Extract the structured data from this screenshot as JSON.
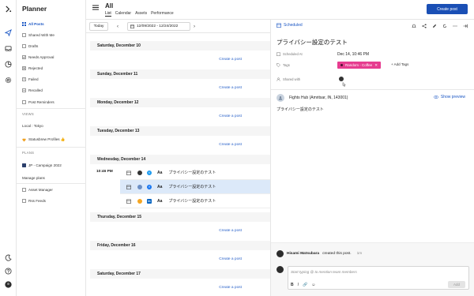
{
  "app": {
    "title": "Planner"
  },
  "sidebar": {
    "items": [
      {
        "label": "All Posts",
        "icon": "grid-icon"
      },
      {
        "label": "Shared With Me",
        "icon": "share-icon"
      },
      {
        "label": "Drafts",
        "icon": "draft-icon"
      },
      {
        "label": "Needs Approval",
        "icon": "approval-icon"
      },
      {
        "label": "Rejected",
        "icon": "rejected-icon"
      },
      {
        "label": "Failed",
        "icon": "failed-icon"
      },
      {
        "label": "Recalled",
        "icon": "recalled-icon"
      },
      {
        "label": "Post Reminders",
        "icon": "reminder-icon"
      }
    ],
    "views_heading": "VIEWS",
    "views": [
      {
        "label": "Local : Tokyo",
        "icon": ""
      },
      {
        "label": "Statusbrew Profiles 👍",
        "icon": "heart-icon"
      }
    ],
    "plans_heading": "PLANS",
    "plans": [
      {
        "label": "JP - Campaign 2022"
      },
      {
        "label": "Manage plans"
      }
    ],
    "tools": [
      {
        "label": "Asset Manager"
      },
      {
        "label": "Rss Feeds"
      }
    ]
  },
  "header": {
    "title": "All",
    "tabs": [
      "List",
      "Calendar",
      "Assets",
      "Performance"
    ],
    "create_label": "Create post"
  },
  "toolbar": {
    "today_label": "Today",
    "prev": "‹",
    "next": "›",
    "date_range": "12/09/2022 - 12/24/2022"
  },
  "calendar": {
    "create_label": "Create a post",
    "days": [
      "Saturday, December 10",
      "Sunday, December 11",
      "Monday, December 12",
      "Tuesday, December 13",
      "Wednesday, December 14",
      "Thursday, December 15",
      "Friday, December 16",
      "Saturday, December 17"
    ],
    "time": "10:46 PM",
    "posts": [
      {
        "network": "twitter",
        "aa": "Aa",
        "text": "プライバシー設定のテスト",
        "selected": false
      },
      {
        "network": "facebook",
        "aa": "Aa",
        "text": "プライバシー設定のテスト",
        "selected": true
      },
      {
        "network": "linkedin",
        "aa": "Aa",
        "text": "プライバシー設定のテスト",
        "selected": false
      }
    ]
  },
  "panel": {
    "status": "Scheduled",
    "title": "プライバシー設定のテスト",
    "scheduled_label": "Scheduled At",
    "scheduled_value": "Dec 14, 10:46 PM",
    "tags_label": "Tags",
    "tag": "Random - Coffee",
    "add_tag": "Add Tags",
    "shared_label": "Shared with",
    "account": "Fights Hub (Amritsar, IN, 143001)",
    "show_preview": "Show preview",
    "body": "プライバシー設定のテスト",
    "activity_user": "Hisami Matsubara",
    "activity_action": "created this post.",
    "activity_time": "1m",
    "comment_placeholder": "Start typing @ to mention team members",
    "fmt_bold": "B",
    "fmt_italic": "I",
    "fmt_link": "🔗",
    "fmt_emoji": "☺",
    "add_label": "Add"
  },
  "colors": {
    "accent": "#1a4fb5",
    "tag": "#e63c8f",
    "selected_row": "#dce9f9",
    "link": "#2a62c9"
  }
}
